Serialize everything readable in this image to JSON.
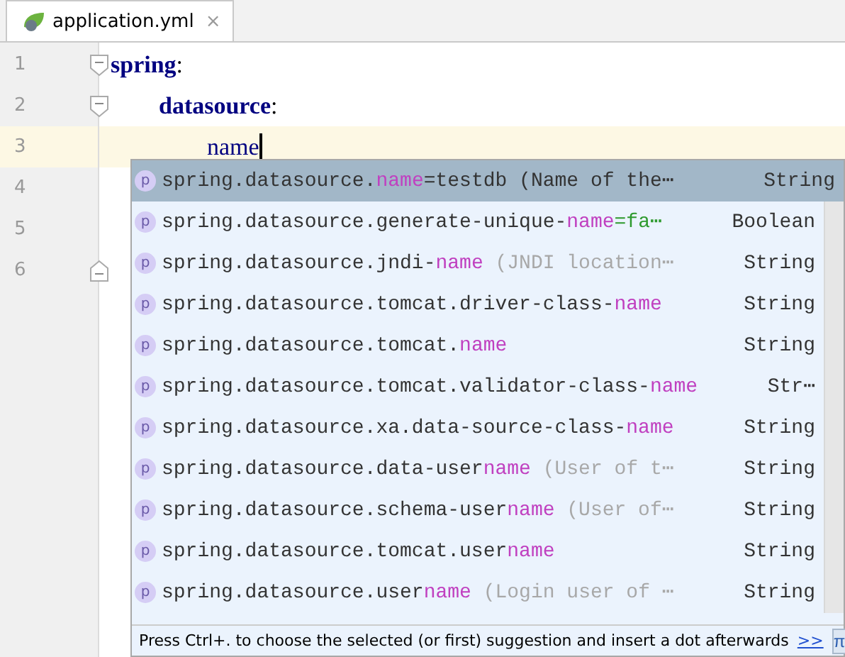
{
  "tab": {
    "title": "application.yml",
    "close": "×",
    "selected": true
  },
  "editor": {
    "lines": [
      {
        "number": "1",
        "key": "spring",
        "colon": ":",
        "kind": "block",
        "current": false,
        "children": [
          {
            "number": "2",
            "key": "datasource",
            "colon": ":",
            "kind": "block",
            "current": false,
            "children": [
              {
                "number": "3",
                "key": "name",
                "current": true
              }
            ]
          }
        ]
      },
      {
        "number": "4",
        "kind": "blank",
        "current": false
      },
      {
        "number": "5",
        "kind": "blank",
        "current": false
      },
      {
        "number": "6",
        "kind": "block_end",
        "current": false
      }
    ]
  },
  "completion": {
    "items": [
      {
        "badge": "p",
        "before": "spring.datasource.",
        "match": "name",
        "detail": "=testdb (Name of the⋯",
        "type": "String",
        "selected": true
      },
      {
        "badge": "p",
        "before": "spring.datasource.generate-unique-",
        "match": "name",
        "value": "=fa⋯",
        "type": "Boolean",
        "selected": false
      },
      {
        "badge": "p",
        "before": "spring.datasource.jndi-",
        "match": "name",
        "hint": " (JNDI location⋯",
        "type": "String",
        "selected": false
      },
      {
        "badge": "p",
        "before": "spring.datasource.tomcat.driver-class-",
        "match": "name",
        "type": "String",
        "selected": false
      },
      {
        "badge": "p",
        "before": "spring.datasource.tomcat.",
        "match": "name",
        "type": "String",
        "selected": false
      },
      {
        "badge": "p",
        "before": "spring.datasource.tomcat.validator-class-",
        "match": "name",
        "type": "Str⋯",
        "selected": false
      },
      {
        "badge": "p",
        "before": "spring.datasource.xa.data-source-class-",
        "match": "name",
        "type": "String",
        "selected": false
      },
      {
        "badge": "p",
        "before": "spring.datasource.data-user",
        "match": "name",
        "hint": " (User of t⋯",
        "type": "String",
        "selected": false
      },
      {
        "badge": "p",
        "before": "spring.datasource.schema-user",
        "match": "name",
        "hint": " (User of⋯",
        "type": "String",
        "selected": false
      },
      {
        "badge": "p",
        "before": "spring.datasource.tomcat.user",
        "match": "name",
        "type": "String",
        "selected": false
      },
      {
        "badge": "p",
        "before": "spring.datasource.user",
        "match": "name",
        "hint": " (Login user of ⋯",
        "type": "String",
        "selected": false
      }
    ],
    "footer": {
      "hint": "Press Ctrl+. to choose the selected (or first) suggestion and insert a dot afterwards",
      "link": ">>",
      "pin": "π"
    }
  }
}
